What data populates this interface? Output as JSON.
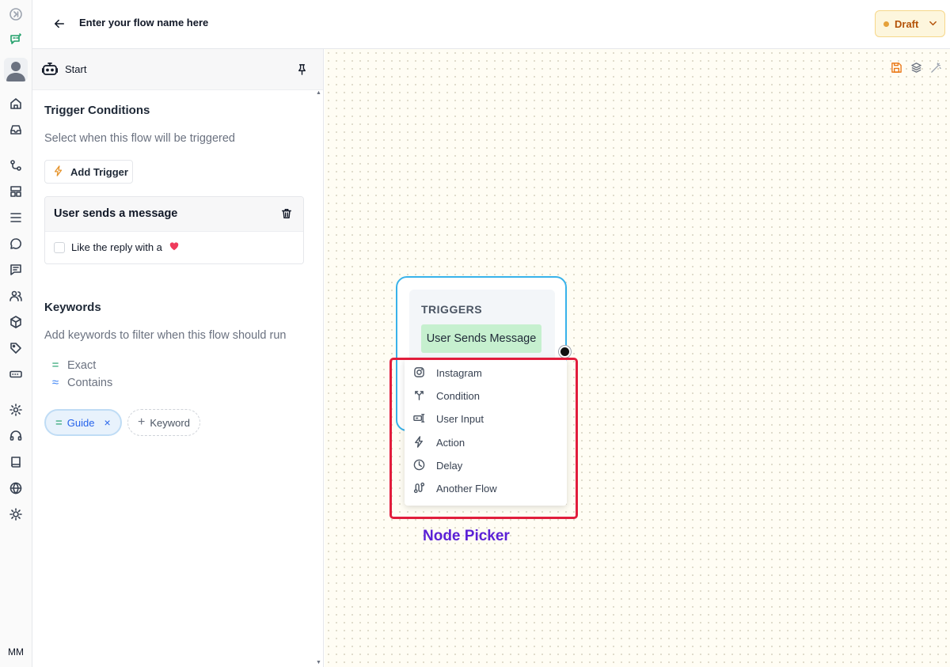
{
  "header": {
    "flow_name": "Enter your flow name here",
    "status_label": "Draft"
  },
  "rail": {
    "initials": "MM",
    "icons": [
      "expand-icon",
      "chat-flow-icon",
      "avatar",
      "home-icon",
      "inbox-icon",
      "flows-icon",
      "templates-icon",
      "list-icon",
      "comment-icon",
      "messages-icon",
      "users-icon",
      "box-icon",
      "tag-icon",
      "input-icon",
      "settings-icon",
      "support-icon",
      "book-icon",
      "globe-icon",
      "theme-icon"
    ]
  },
  "panel": {
    "header_label": "Start",
    "trigger_title": "Trigger Conditions",
    "trigger_subtitle": "Select when this flow will be triggered",
    "add_trigger_label": "Add Trigger",
    "trigger_card": {
      "title": "User sends a message",
      "option_label": "Like the reply with a",
      "option_checked": false
    },
    "keywords_title": "Keywords",
    "keywords_subtitle": "Add keywords to filter when this flow should run",
    "match_types": [
      {
        "symbol": "=",
        "label": "Exact"
      },
      {
        "symbol": "≈",
        "label": "Contains"
      }
    ],
    "keyword_chips": [
      {
        "symbol": "=",
        "label": "Guide",
        "remove": "×"
      }
    ],
    "add_keyword_label": "Keyword",
    "add_keyword_symbol": "+"
  },
  "canvas": {
    "node": {
      "title": "TRIGGERS",
      "tag": "User Sends Message"
    },
    "picker_items": [
      {
        "icon": "instagram-icon",
        "label": "Instagram"
      },
      {
        "icon": "condition-icon",
        "label": "Condition"
      },
      {
        "icon": "user-input-icon",
        "label": "User Input"
      },
      {
        "icon": "action-icon",
        "label": "Action"
      },
      {
        "icon": "delay-icon",
        "label": "Delay"
      },
      {
        "icon": "another-flow-icon",
        "label": "Another Flow"
      }
    ],
    "picker_caption": "Node Picker",
    "highlight_color": "#e11d3c",
    "caption_color": "#5b21d6"
  },
  "colors": {
    "accent_blue": "#38b2ea",
    "trigger_green": "#c6f0cf",
    "draft_text": "#b45309",
    "canvas_bg": "#fffdf4"
  }
}
